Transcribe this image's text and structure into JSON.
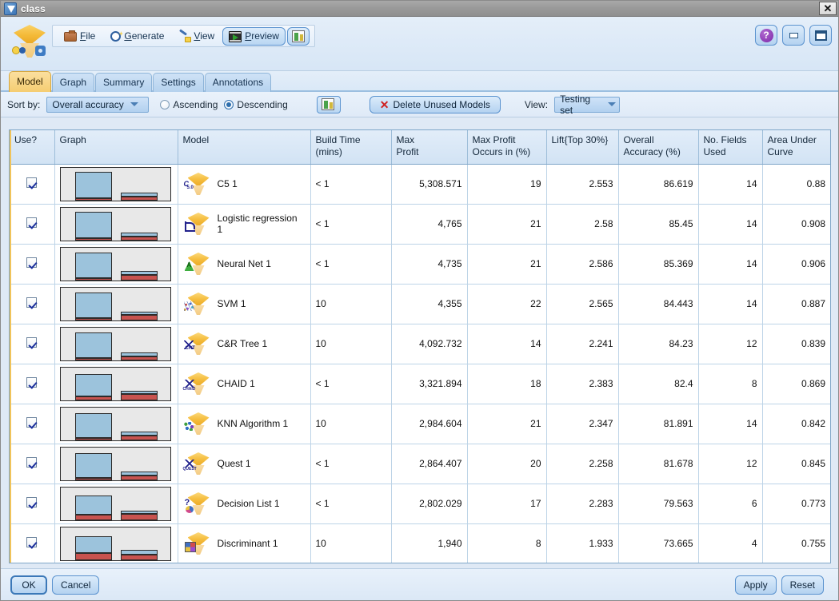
{
  "window": {
    "title": "class",
    "close_label": "✕",
    "help_label": "?",
    "minimize_label": "",
    "maximize_label": ""
  },
  "toolbar": {
    "file": "File",
    "generate": "Generate",
    "view": "View",
    "preview": "Preview"
  },
  "tabs": [
    {
      "label": "Model",
      "active": true
    },
    {
      "label": "Graph",
      "active": false
    },
    {
      "label": "Summary",
      "active": false
    },
    {
      "label": "Settings",
      "active": false
    },
    {
      "label": "Annotations",
      "active": false
    }
  ],
  "options": {
    "sort_by_label": "Sort by:",
    "sort_by_value": "Overall accuracy",
    "ascending_label": "Ascending",
    "descending_label": "Descending",
    "ascending_selected": false,
    "descending_selected": true,
    "delete_unused_label": "Delete Unused Models",
    "view_label": "View:",
    "view_value": "Testing set"
  },
  "table": {
    "columns": [
      "Use?",
      "Graph",
      "Model",
      "Build Time (mins)",
      "Max Profit",
      "Max Profit Occurs in (%)",
      "Lift{Top 30%}",
      "Overall Accuracy (%)",
      "No. Fields Used",
      "Area Under Curve"
    ],
    "columns_lines": [
      [
        "Use?"
      ],
      [
        "Graph"
      ],
      [
        "Model"
      ],
      [
        "Build Time",
        "(mins)"
      ],
      [
        "Max",
        "Profit"
      ],
      [
        "Max Profit",
        "Occurs in (%)"
      ],
      [
        "Lift{Top 30%}"
      ],
      [
        "Overall",
        "Accuracy (%)"
      ],
      [
        "No. Fields",
        "Used"
      ],
      [
        "Area Under",
        "Curve"
      ]
    ],
    "rows": [
      {
        "use": true,
        "icon": "c5-model-icon",
        "model": "C5 1",
        "build_time": "< 1",
        "max_profit": "5,308.571",
        "max_profit_occurs": "19",
        "lift": "2.553",
        "accuracy": "86.619",
        "fields": "14",
        "auc": "0.88",
        "bars": {
          "tall_blue": 0.88,
          "tall_red": 0.04,
          "short_blue": 0.13,
          "short_red": 0.11
        }
      },
      {
        "use": true,
        "icon": "logistic-regression-model-icon",
        "model": "Logistic regression 1",
        "build_time": "< 1",
        "max_profit": "4,765",
        "max_profit_occurs": "21",
        "lift": "2.58",
        "accuracy": "85.45",
        "fields": "14",
        "auc": "0.908",
        "bars": {
          "tall_blue": 0.87,
          "tall_red": 0.06,
          "short_blue": 0.11,
          "short_red": 0.13
        }
      },
      {
        "use": true,
        "icon": "neural-net-model-icon",
        "model": "Neural Net 1",
        "build_time": "< 1",
        "max_profit": "4,735",
        "max_profit_occurs": "21",
        "lift": "2.586",
        "accuracy": "85.369",
        "fields": "14",
        "auc": "0.906",
        "bars": {
          "tall_blue": 0.86,
          "tall_red": 0.07,
          "short_blue": 0.12,
          "short_red": 0.17
        }
      },
      {
        "use": true,
        "icon": "svm-model-icon",
        "model": "SVM 1",
        "build_time": "10",
        "max_profit": "4,355",
        "max_profit_occurs": "22",
        "lift": "2.565",
        "accuracy": "84.443",
        "fields": "14",
        "auc": "0.887",
        "bars": {
          "tall_blue": 0.86,
          "tall_red": 0.05,
          "short_blue": 0.1,
          "short_red": 0.18
        }
      },
      {
        "use": true,
        "icon": "cart-model-icon",
        "model": "C&R Tree 1",
        "build_time": "10",
        "max_profit": "4,092.732",
        "max_profit_occurs": "14",
        "lift": "2.241",
        "accuracy": "84.23",
        "fields": "12",
        "auc": "0.839",
        "bars": {
          "tall_blue": 0.86,
          "tall_red": 0.05,
          "short_blue": 0.12,
          "short_red": 0.13
        }
      },
      {
        "use": true,
        "icon": "chaid-model-icon",
        "model": "CHAID  1",
        "build_time": "< 1",
        "max_profit": "3,321.894",
        "max_profit_occurs": "18",
        "lift": "2.383",
        "accuracy": "82.4",
        "fields": "8",
        "auc": "0.869",
        "bars": {
          "tall_blue": 0.8,
          "tall_red": 0.11,
          "short_blue": 0.09,
          "short_red": 0.19
        }
      },
      {
        "use": true,
        "icon": "knn-model-icon",
        "model": "KNN Algorithm 1",
        "build_time": "10",
        "max_profit": "2,984.604",
        "max_profit_occurs": "21",
        "lift": "2.347",
        "accuracy": "81.891",
        "fields": "14",
        "auc": "0.842",
        "bars": {
          "tall_blue": 0.83,
          "tall_red": 0.08,
          "short_blue": 0.12,
          "short_red": 0.14
        }
      },
      {
        "use": true,
        "icon": "quest-model-icon",
        "model": "Quest  1",
        "build_time": "< 1",
        "max_profit": "2,864.407",
        "max_profit_occurs": "20",
        "lift": "2.258",
        "accuracy": "81.678",
        "fields": "12",
        "auc": "0.845",
        "bars": {
          "tall_blue": 0.83,
          "tall_red": 0.08,
          "short_blue": 0.13,
          "short_red": 0.14
        }
      },
      {
        "use": true,
        "icon": "decision-list-model-icon",
        "model": "Decision List 1",
        "build_time": "< 1",
        "max_profit": "2,802.029",
        "max_profit_occurs": "17",
        "lift": "2.283",
        "accuracy": "79.563",
        "fields": "6",
        "auc": "0.773",
        "bars": {
          "tall_blue": 0.76,
          "tall_red": 0.18,
          "short_blue": 0.08,
          "short_red": 0.19
        }
      },
      {
        "use": true,
        "icon": "discriminant-model-icon",
        "model": "Discriminant 1",
        "build_time": "10",
        "max_profit": "1,940",
        "max_profit_occurs": "8",
        "lift": "1.933",
        "accuracy": "73.665",
        "fields": "4",
        "auc": "0.755",
        "bars": {
          "tall_blue": 0.72,
          "tall_red": 0.22,
          "short_blue": 0.14,
          "short_red": 0.16
        }
      }
    ]
  },
  "buttons": {
    "ok": "OK",
    "cancel": "Cancel",
    "apply": "Apply",
    "reset": "Reset"
  },
  "colors": {
    "accent": "#f5cd72",
    "chart_blue": "#9cc3dc",
    "chart_red": "#c8534f",
    "title_bar": "#9a9a9a",
    "panel": "#dfe9f5"
  }
}
